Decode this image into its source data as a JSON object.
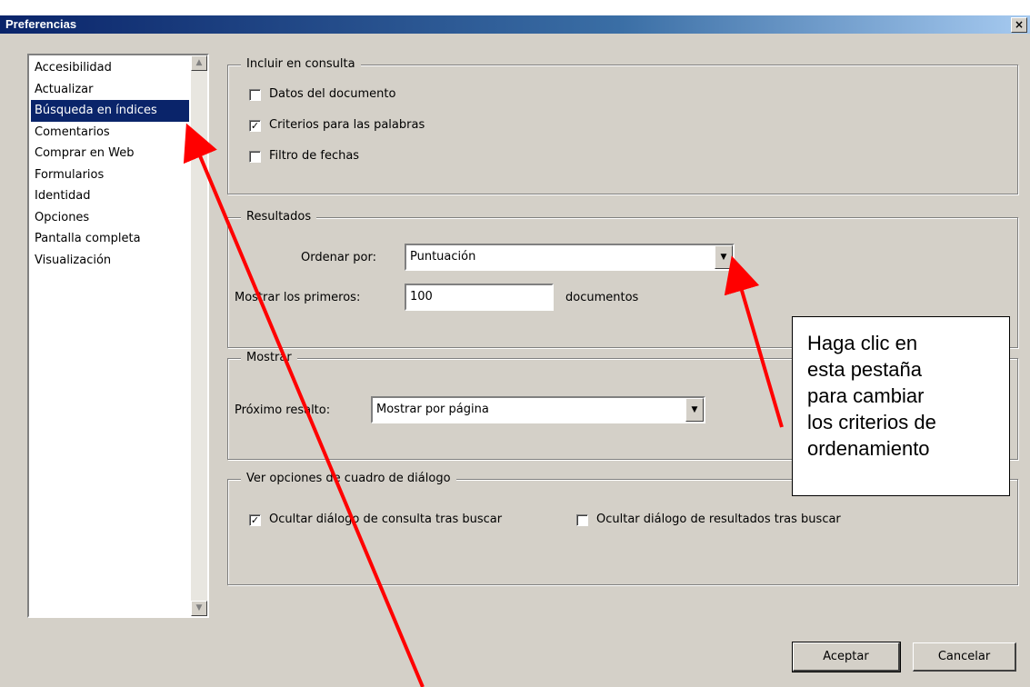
{
  "window": {
    "title": "Preferencias",
    "close_glyph": "×"
  },
  "sidebar": {
    "items": [
      {
        "label": "Accesibilidad",
        "selected": false
      },
      {
        "label": "Actualizar",
        "selected": false
      },
      {
        "label": "Búsqueda en índices",
        "selected": true
      },
      {
        "label": "Comentarios",
        "selected": false
      },
      {
        "label": "Comprar en Web",
        "selected": false
      },
      {
        "label": "Formularios",
        "selected": false
      },
      {
        "label": "Identidad",
        "selected": false
      },
      {
        "label": "Opciones",
        "selected": false
      },
      {
        "label": "Pantalla completa",
        "selected": false
      },
      {
        "label": "Visualización",
        "selected": false
      }
    ]
  },
  "incluir": {
    "title": "Incluir en consulta",
    "options": [
      {
        "label": "Datos del documento",
        "checked": false
      },
      {
        "label": "Criterios para las palabras",
        "checked": true
      },
      {
        "label": "Filtro de fechas",
        "checked": false
      }
    ]
  },
  "resultados": {
    "title": "Resultados",
    "ordenar_label": "Ordenar por:",
    "ordenar_value": "Puntuación",
    "mostrar_label": "Mostrar los primeros:",
    "mostrar_value": "100",
    "mostrar_suffix": "documentos"
  },
  "mostrar": {
    "title": "Mostrar",
    "proximo_label": "Próximo resalto:",
    "proximo_value": "Mostrar por página"
  },
  "ver": {
    "title": "Ver opciones de cuadro de diálogo",
    "opt1": {
      "label": "Ocultar diálogo de consulta tras buscar",
      "checked": true
    },
    "opt2": {
      "label": "Ocultar diálogo de resultados tras buscar",
      "checked": false
    }
  },
  "buttons": {
    "ok": "Aceptar",
    "cancel": "Cancelar"
  },
  "callout": {
    "lines": [
      "Haga clic en",
      "esta pestaña",
      "para cambiar",
      "los criterios de",
      "ordenamiento"
    ]
  },
  "colors": {
    "dialog": "#d4d0c8",
    "title_start": "#0a246a",
    "selection": "#0a246a",
    "arrow": "#ff0000"
  }
}
